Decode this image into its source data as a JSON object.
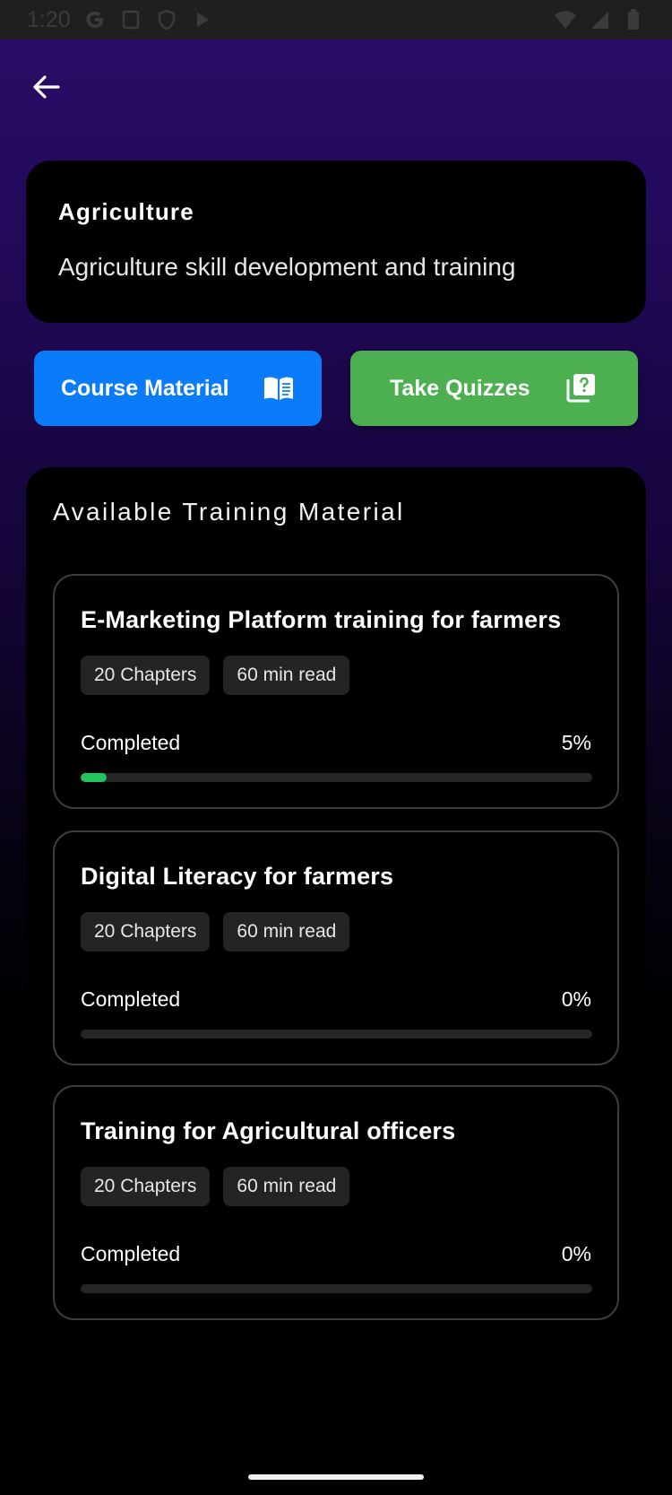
{
  "status_bar": {
    "time": "1:20",
    "left_icons": [
      "google-g-icon",
      "screenshot-icon",
      "shield-icon",
      "play-icon"
    ],
    "right_icons": [
      "wifi-icon",
      "signal-icon",
      "battery-icon"
    ]
  },
  "header": {
    "title": "Agriculture",
    "description": "Agriculture skill development and training"
  },
  "actions": {
    "course_material": {
      "label": "Course Material",
      "icon": "book-icon",
      "color": "#0a7cfa"
    },
    "take_quizzes": {
      "label": "Take Quizzes",
      "icon": "quiz-icon",
      "color": "#4caf50"
    }
  },
  "training": {
    "title": "Available Training Material",
    "courses": [
      {
        "title": "E-Marketing Platform training for farmers",
        "chapters": "20 Chapters",
        "read_time": "60 min read",
        "completed_label": "Completed",
        "percent_label": "5%",
        "progress": 0.05
      },
      {
        "title": "Digital Literacy for farmers",
        "chapters": "20 Chapters",
        "read_time": "60 min read",
        "completed_label": "Completed",
        "percent_label": "0%",
        "progress": 0
      },
      {
        "title": "Training for Agricultural officers",
        "chapters": "20 Chapters",
        "read_time": "60 min read",
        "completed_label": "Completed",
        "percent_label": "0%",
        "progress": 0
      }
    ]
  },
  "colors": {
    "progress_fill": "#22c55e",
    "panel_bg": "#000000"
  }
}
